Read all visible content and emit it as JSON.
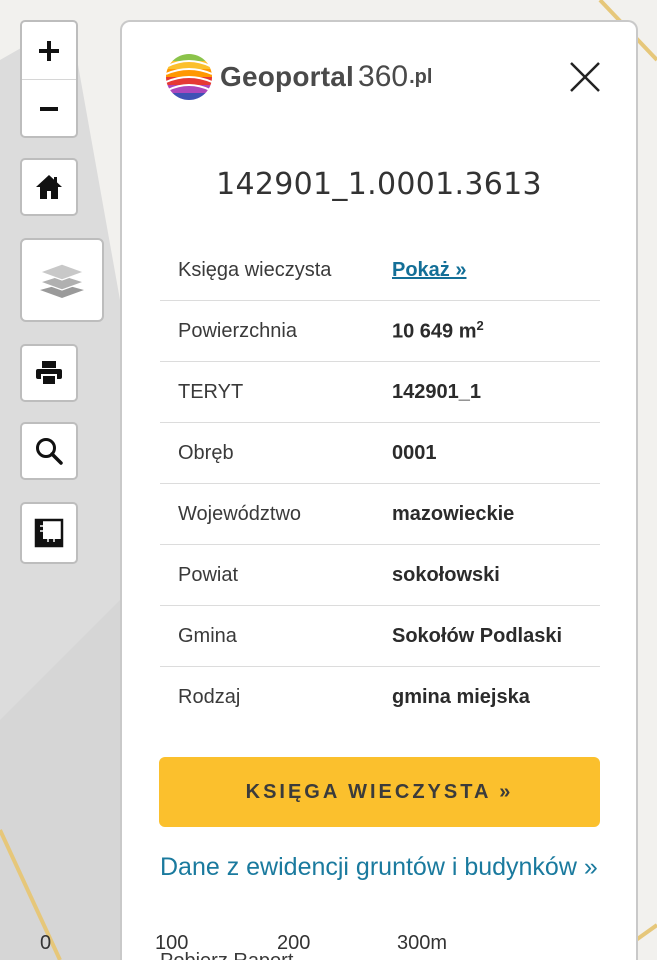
{
  "logo": {
    "name": "Geoportal",
    "number": "360",
    "tld": ".pl"
  },
  "parcel": {
    "id": "142901_1.0001.3613"
  },
  "details": [
    {
      "label": "Księga wieczysta",
      "value": "Pokaż »",
      "link": true
    },
    {
      "label": "Powierzchnia",
      "value": "10 649 m",
      "sup": "2"
    },
    {
      "label": "TERYT",
      "value": "142901_1"
    },
    {
      "label": "Obręb",
      "value": "0001"
    },
    {
      "label": "Województwo",
      "value": "mazowieckie"
    },
    {
      "label": "Powiat",
      "value": "sokołowski"
    },
    {
      "label": "Gmina",
      "value": "Sokołów Podlaski"
    },
    {
      "label": "Rodzaj",
      "value": "gmina miejska"
    }
  ],
  "actions": {
    "kw_button_label": "KSIĘGA WIECZYSTA »",
    "egib_link": "Dane z ewidencji gruntów i budynków »",
    "report_link": "Pobierz Raport"
  },
  "scale_bar": [
    "0",
    "100",
    "200",
    "300m"
  ],
  "icons": {
    "zoom_in": "plus-icon",
    "zoom_out": "minus-icon",
    "home": "home-icon",
    "layers": "layers-icon",
    "print": "print-icon",
    "search": "search-icon",
    "measure": "ruler-icon",
    "close": "close-icon"
  },
  "colors": {
    "accent": "#fbc02d",
    "link": "#136f97",
    "egib_link": "#1a7a9e",
    "parcel_outline": "#c5d6f0"
  }
}
